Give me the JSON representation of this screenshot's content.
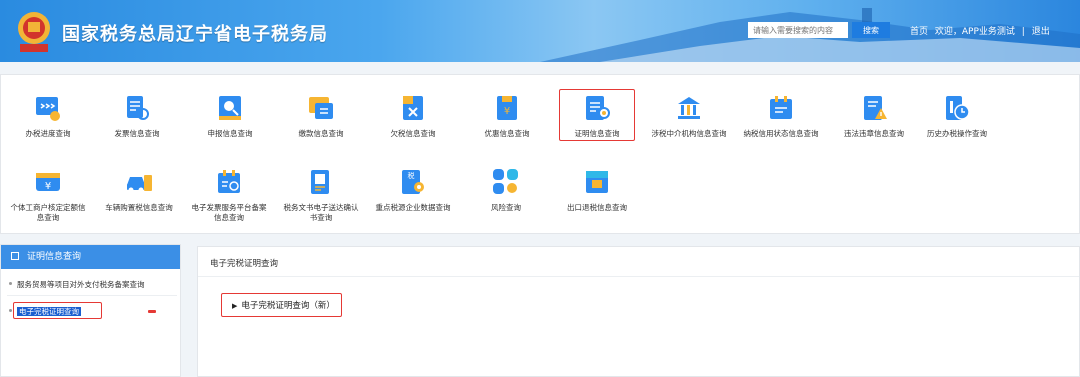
{
  "header": {
    "site_title": "国家税务总局辽宁省电子税务局",
    "search_placeholder": "请输入需要搜索的内容",
    "search_button": "搜索",
    "nav": {
      "home": "首页",
      "welcome": "欢迎，APP业务测试",
      "separator": "|",
      "logout": "退出"
    }
  },
  "icons_row1": [
    {
      "label": "办税进度查询",
      "icon": "progress-icon"
    },
    {
      "label": "发票信息查询",
      "icon": "invoice-icon"
    },
    {
      "label": "申报信息查询",
      "icon": "declare-icon"
    },
    {
      "label": "缴款信息查询",
      "icon": "payment-icon"
    },
    {
      "label": "欠税信息查询",
      "icon": "arrears-icon"
    },
    {
      "label": "优惠信息查询",
      "icon": "discount-icon"
    },
    {
      "label": "证明信息查询",
      "icon": "certificate-icon"
    },
    {
      "label": "涉税中介机构信息查询",
      "icon": "agency-icon"
    },
    {
      "label": "纳税信用状态信息查询",
      "icon": "credit-icon"
    },
    {
      "label": "违法违章信息查询",
      "icon": "violation-icon"
    },
    {
      "label": "历史办税操作查询",
      "icon": "history-icon"
    }
  ],
  "icons_row2": [
    {
      "label": "个体工商户核定定额信息查询",
      "icon": "individual-icon"
    },
    {
      "label": "车辆购置税信息查询",
      "icon": "vehicle-icon"
    },
    {
      "label": "电子发票服务平台备案信息查询",
      "icon": "e-invoice-icon"
    },
    {
      "label": "税务文书电子送达确认书查询",
      "icon": "document-icon"
    },
    {
      "label": "重点税源企业数据查询",
      "icon": "key-source-icon"
    },
    {
      "label": "风险查询",
      "icon": "risk-icon"
    },
    {
      "label": "出口退税信息查询",
      "icon": "export-refund-icon"
    }
  ],
  "sidebar": {
    "title": "证明信息查询",
    "items": [
      {
        "label": "服务贸易等项目对外支付税务备案查询"
      },
      {
        "label": "电子完税证明查询"
      }
    ]
  },
  "content": {
    "title": "电子完税证明查询",
    "link": "电子完税证明查询（新）"
  },
  "colors": {
    "header_blue": "#2a8be0",
    "accent_blue": "#1e7ce0",
    "highlight_red": "#e53935",
    "sidebar_head": "#3b8fe6"
  }
}
